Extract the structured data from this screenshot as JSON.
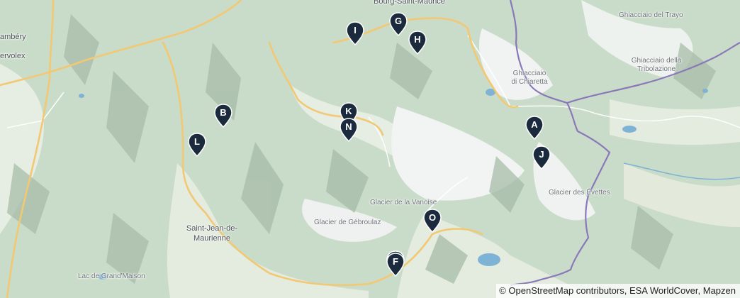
{
  "map": {
    "colors": {
      "land": "#c9dcc9",
      "valley": "#e9efe6",
      "snow": "#f4f6f7",
      "shadow": "#9fb4a1",
      "road_major": "#f2c873",
      "road_minor": "#ffffff",
      "water": "#7fb3d5",
      "border": "#8a78b8",
      "marker": "#1c2a3d"
    },
    "places": [
      {
        "id": "bourg",
        "text": "Bourg-Saint-Maurice"
      },
      {
        "id": "chambery",
        "text": "ambéry"
      },
      {
        "id": "voglans",
        "text": "ervolex"
      },
      {
        "id": "trayo",
        "text": "Ghiacciaio del Trayo"
      },
      {
        "id": "tribolazione_1",
        "text": "Ghiacciaio della"
      },
      {
        "id": "tribolazione_2",
        "text": "Tribolazione"
      },
      {
        "id": "ciardoney_1",
        "text": "Ghiacciaio"
      },
      {
        "id": "ciardoney_2",
        "text": "di Chiaretta"
      },
      {
        "id": "vanoise",
        "text": "Glacier de la Vanoise"
      },
      {
        "id": "gebroulaz",
        "text": "Glacier de Gébroulaz"
      },
      {
        "id": "evettes",
        "text": "Glacier des Évettes"
      },
      {
        "id": "sjdm_1",
        "text": "Saint-Jean-de-"
      },
      {
        "id": "sjdm_2",
        "text": "Maurienne"
      },
      {
        "id": "grandmaison",
        "text": "Lac de Grand'Maison"
      }
    ],
    "markers": [
      {
        "label": "A",
        "name": "marker-a"
      },
      {
        "label": "B",
        "name": "marker-b"
      },
      {
        "label": "F",
        "name": "marker-f"
      },
      {
        "label": "G",
        "name": "marker-g"
      },
      {
        "label": "H",
        "name": "marker-h"
      },
      {
        "label": "I",
        "name": "marker-i"
      },
      {
        "label": "J",
        "name": "marker-j"
      },
      {
        "label": "K",
        "name": "marker-k"
      },
      {
        "label": "L",
        "name": "marker-l"
      },
      {
        "label": "N",
        "name": "marker-n"
      },
      {
        "label": "O",
        "name": "marker-o"
      }
    ],
    "attribution": "© OpenStreetMap contributors, ESA WorldCover, Mapzen"
  }
}
